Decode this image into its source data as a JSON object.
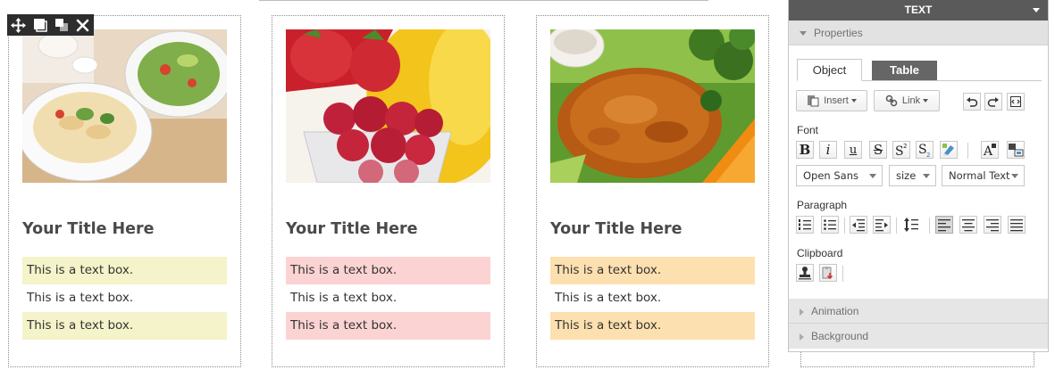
{
  "cards": [
    {
      "image": "pasta-salad-photo",
      "title": "Your Title Here",
      "textboxes": [
        "This is a text box.",
        "This is a text box.",
        "This is a text box."
      ],
      "accent": "#f4f3c9"
    },
    {
      "image": "berries-photo",
      "title": "Your Title Here",
      "textboxes": [
        "This is a text box.",
        "This is a text box.",
        "This is a text box."
      ],
      "accent": "#fcd3d3"
    },
    {
      "image": "grilled-chicken-photo",
      "title": "Your Title Here",
      "textboxes": [
        "This is a text box.",
        "This is a text box.",
        "This is a text box."
      ],
      "accent": "#fde0af"
    }
  ],
  "element_toolbar": {
    "icons": [
      "move-icon",
      "square-icon",
      "layers-icon",
      "close-icon"
    ]
  },
  "panel": {
    "title": "TEXT",
    "sections": {
      "properties": "Properties",
      "animation": "Animation",
      "background": "Background"
    },
    "tabs": {
      "object": "Object",
      "table": "Table"
    },
    "insert_label": "Insert",
    "link_label": "Link",
    "groups": {
      "font": "Font",
      "paragraph": "Paragraph",
      "clipboard": "Clipboard"
    },
    "font_family": "Open Sans",
    "font_size": "size",
    "text_style": "Normal Text",
    "colors": {
      "header_bg": "#5a5a5a",
      "tab_active_bg": "#666666",
      "section_bg": "#e2e2e2"
    }
  }
}
